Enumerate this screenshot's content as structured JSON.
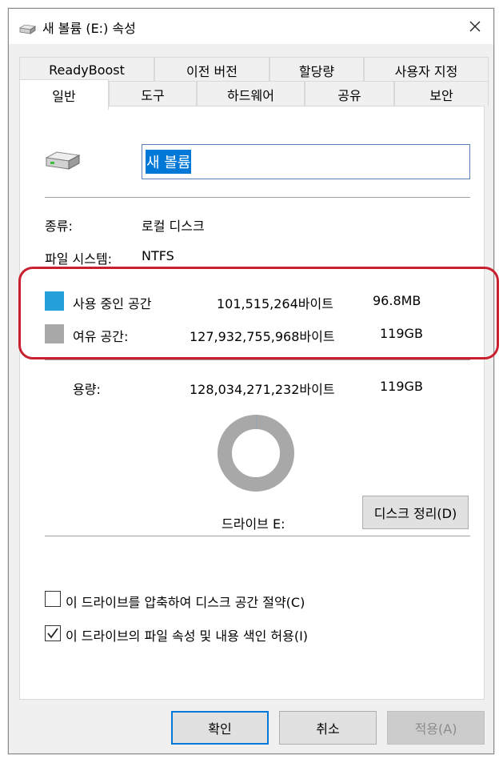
{
  "window": {
    "title": "새 볼륨 (E:) 속성"
  },
  "tabs_top": [
    "ReadyBoost",
    "이전 버전",
    "할당량",
    "사용자 지정"
  ],
  "tabs_bottom": [
    "일반",
    "도구",
    "하드웨어",
    "공유",
    "보안"
  ],
  "general": {
    "volume_name": "새 볼륨",
    "type_label": "종류:",
    "type_value": "로컬 디스크",
    "fs_label": "파일 시스템:",
    "fs_value": "NTFS",
    "used_label": "사용 중인 공간",
    "used_bytes": "101,515,264바이트",
    "used_size": "96.8MB",
    "free_label": "여유 공간:",
    "free_bytes": "127,932,755,968바이트",
    "free_size": "119GB",
    "capacity_label": "용량:",
    "capacity_bytes": "128,034,271,232바이트",
    "capacity_size": "119GB",
    "drive_label": "드라이브 E:",
    "cleanup_button": "디스크 정리(D)",
    "compress_checkbox": "이 드라이브를 압축하여 디스크 공간 절약(C)",
    "index_checkbox": "이 드라이브의 파일 속성 및 내용 색인 허용(I)",
    "used_fraction": 0.0008
  },
  "buttons": {
    "ok": "확인",
    "cancel": "취소",
    "apply": "적용(A)"
  },
  "colors": {
    "used": "#26a0da",
    "free": "#a8a8a8",
    "highlight": "#c8202e"
  }
}
